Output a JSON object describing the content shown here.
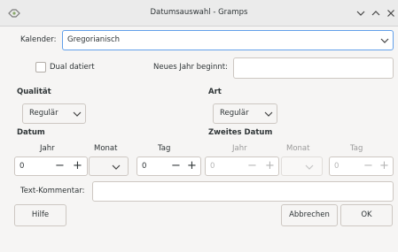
{
  "window": {
    "title": "Datumsauswahl - Gramps",
    "controls": [
      "chevron-down-icon",
      "chevron-up-icon",
      "close-icon"
    ]
  },
  "calendar": {
    "label": "Kalender:",
    "value": "Gregorianisch"
  },
  "dual_dated": {
    "label": "Dual datiert",
    "checked": false
  },
  "new_year": {
    "label": "Neues Jahr beginnt:",
    "value": ""
  },
  "quality": {
    "heading": "Qualität",
    "value": "Regulär"
  },
  "type": {
    "heading": "Art",
    "value": "Regulär"
  },
  "date": {
    "heading": "Datum",
    "year_label": "Jahr",
    "month_label": "Monat",
    "day_label": "Tag",
    "year": "0",
    "month": "",
    "day": "0"
  },
  "second_date": {
    "heading": "Zweites Datum",
    "year_label": "Jahr",
    "month_label": "Monat",
    "day_label": "Tag",
    "year": "0",
    "month": "",
    "day": "0"
  },
  "text_comment": {
    "label": "Text-Kommentar:",
    "value": ""
  },
  "buttons": {
    "help": "Hilfe",
    "cancel": "Abbrechen",
    "ok": "OK"
  },
  "spin": {
    "minus": "−",
    "plus": "+"
  }
}
